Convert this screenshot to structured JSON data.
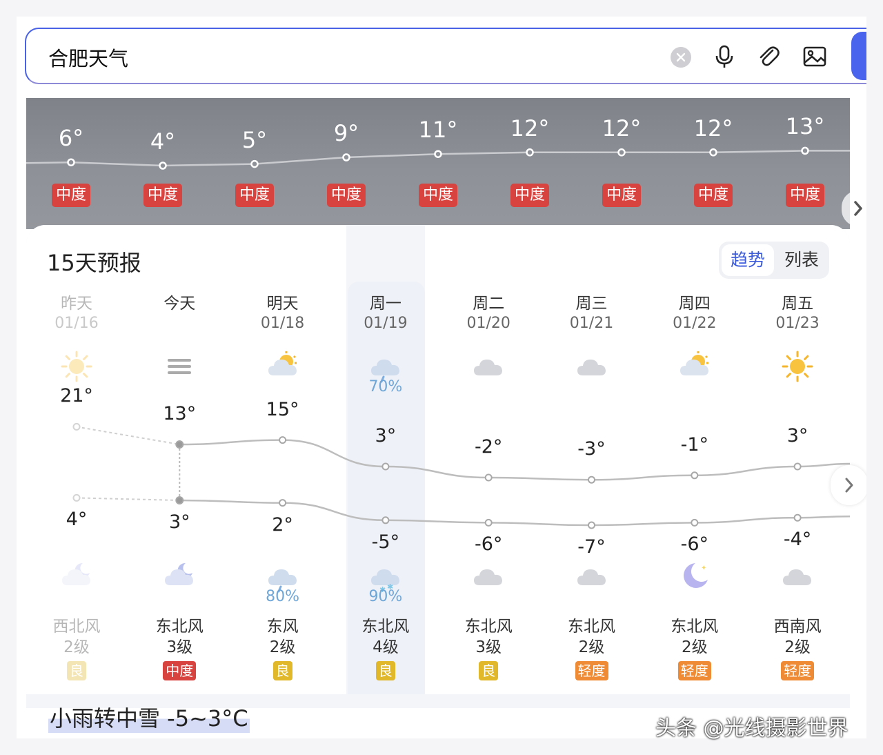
{
  "search": {
    "query": "合肥天气"
  },
  "hourly": {
    "temps": [
      "6°",
      "4°",
      "5°",
      "9°",
      "11°",
      "12°",
      "12°",
      "12°",
      "13°"
    ],
    "temp_values": [
      6,
      4,
      5,
      9,
      11,
      12,
      12,
      12,
      13
    ],
    "aqi": [
      "中度",
      "中度",
      "中度",
      "中度",
      "中度",
      "中度",
      "中度",
      "中度",
      "中度"
    ],
    "aqi_color": "#d8433f"
  },
  "forecast": {
    "title": "15天预报",
    "tabs": {
      "trend": "趋势",
      "list": "列表"
    },
    "days": [
      {
        "name": "昨天",
        "date": "01/16",
        "day_icon": "sun-icon",
        "precip_day": "",
        "hi": "21°",
        "hi_v": 21,
        "lo": "4°",
        "lo_v": 4,
        "night_icon": "moon-cloud-icon",
        "precip_night": "",
        "wind_dir": "西北风",
        "wind_level": "2级",
        "aqi": "良",
        "aqi_color": "#e0b82a"
      },
      {
        "name": "今天",
        "date": "",
        "day_icon": "haze-icon",
        "precip_day": "",
        "hi": "13°",
        "hi_v": 13,
        "lo": "3°",
        "lo_v": 3,
        "night_icon": "moon-cloud-icon",
        "precip_night": "",
        "wind_dir": "东北风",
        "wind_level": "3级",
        "aqi": "中度",
        "aqi_color": "#d8433f"
      },
      {
        "name": "明天",
        "date": "01/18",
        "day_icon": "partly-cloudy-icon",
        "precip_day": "",
        "hi": "15°",
        "hi_v": 15,
        "lo": "2°",
        "lo_v": 2,
        "night_icon": "rain-icon",
        "precip_night": "80%",
        "wind_dir": "东风",
        "wind_level": "2级",
        "aqi": "良",
        "aqi_color": "#e0b82a"
      },
      {
        "name": "周一",
        "date": "01/19",
        "day_icon": "rain-icon",
        "precip_day": "70%",
        "hi": "3°",
        "hi_v": 3,
        "lo": "-5°",
        "lo_v": -5,
        "night_icon": "snow-icon",
        "precip_night": "90%",
        "wind_dir": "东北风",
        "wind_level": "4级",
        "aqi": "良",
        "aqi_color": "#e0b82a"
      },
      {
        "name": "周二",
        "date": "01/20",
        "day_icon": "cloud-icon",
        "precip_day": "",
        "hi": "-2°",
        "hi_v": -2,
        "lo": "-6°",
        "lo_v": -6,
        "night_icon": "cloud-icon",
        "precip_night": "",
        "wind_dir": "东北风",
        "wind_level": "3级",
        "aqi": "良",
        "aqi_color": "#e0b82a"
      },
      {
        "name": "周三",
        "date": "01/21",
        "day_icon": "cloud-icon",
        "precip_day": "",
        "hi": "-3°",
        "hi_v": -3,
        "lo": "-7°",
        "lo_v": -7,
        "night_icon": "cloud-icon",
        "precip_night": "",
        "wind_dir": "东北风",
        "wind_level": "2级",
        "aqi": "轻度",
        "aqi_color": "#ef8b34"
      },
      {
        "name": "周四",
        "date": "01/22",
        "day_icon": "partly-cloudy-icon",
        "precip_day": "",
        "hi": "-1°",
        "hi_v": -1,
        "lo": "-6°",
        "lo_v": -6,
        "night_icon": "moon-icon",
        "precip_night": "",
        "wind_dir": "东北风",
        "wind_level": "2级",
        "aqi": "轻度",
        "aqi_color": "#ef8b34"
      },
      {
        "name": "周五",
        "date": "01/23",
        "day_icon": "sun-icon",
        "precip_day": "",
        "hi": "3°",
        "hi_v": 3,
        "lo": "-4°",
        "lo_v": -4,
        "night_icon": "cloud-icon",
        "precip_night": "",
        "wind_dir": "西南风",
        "wind_level": "2级",
        "aqi": "轻度",
        "aqi_color": "#ef8b34"
      }
    ]
  },
  "summary": "小雨转中雪 -5~3°C",
  "watermark": "头条 @光线摄影世界"
}
